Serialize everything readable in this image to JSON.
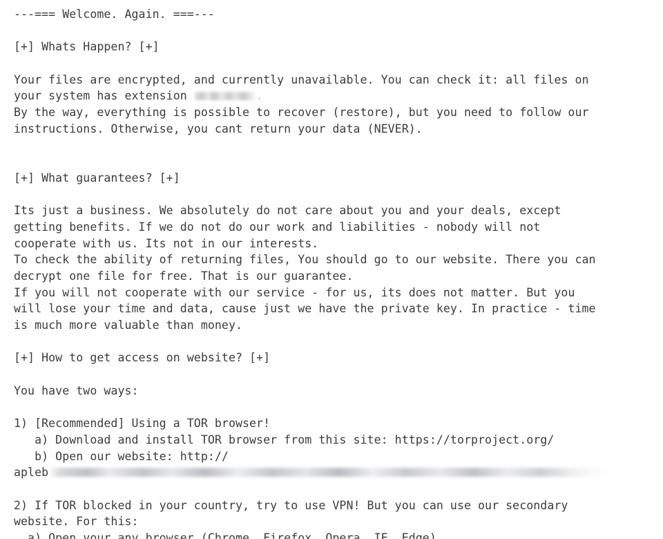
{
  "document": {
    "type": "ransom-note",
    "background_color": "#ffffff",
    "text_color": "#3c3c3c",
    "redaction_color": "#b4b6bb",
    "title_banner": "---=== Welcome. Again. ===---",
    "sections": [
      {
        "heading": "[+] Whats Happen? [+]",
        "lines": [
          "Your files are encrypted, and currently unavailable. You can check it: all files on",
          "your system has extension ",
          "By the way, everything is possible to recover (restore), but you need to follow our",
          "instructions. Otherwise, you cant return your data (NEVER)."
        ]
      },
      {
        "heading": "[+] What guarantees? [+]",
        "lines": [
          "Its just a business. We absolutely do not care about you and your deals, except",
          "getting benefits. If we do not do our work and liabilities - nobody will not",
          "cooperate with us. Its not in our interests.",
          "To check the ability of returning files, You should go to our website. There you can",
          "decrypt one file for free. That is our guarantee.",
          "If you will not cooperate with our service - for us, its does not matter. But you",
          "will lose your time and data, cause just we have the private key. In practice - time",
          "is much more valuable than money."
        ]
      },
      {
        "heading": "[+] How to get access on website? [+]",
        "lines": [
          "You have two ways:",
          "1) [Recommended] Using a TOR browser!",
          "   a) Download and install TOR browser from this site: https://torproject.org/",
          "   b) Open our website: http://",
          "apleb",
          "2) If TOR blocked in your country, try to use VPN! But you can use our secondary",
          "website. For this:"
        ]
      }
    ]
  },
  "text": {
    "banner": "---=== Welcome. Again. ===---",
    "h1": "[+] Whats Happen? [+]",
    "p1_l1": "Your files are encrypted, and currently unavailable. You can check it: all files on",
    "p1_l2_prefix": "your system has extension ",
    "p1_l2_suffix": ".",
    "p1_l3": "By the way, everything is possible to recover (restore), but you need to follow our",
    "p1_l4": "instructions. Otherwise, you cant return your data (NEVER).",
    "h2": "[+] What guarantees? [+]",
    "p2_l1": "Its just a business. We absolutely do not care about you and your deals, except",
    "p2_l2": "getting benefits. If we do not do our work and liabilities - nobody will not",
    "p2_l3": "cooperate with us. Its not in our interests.",
    "p2_l4": "To check the ability of returning files, You should go to our website. There you can",
    "p2_l5": "decrypt one file for free. That is our guarantee.",
    "p2_l6": "If you will not cooperate with our service - for us, its does not matter. But you",
    "p2_l7": "will lose your time and data, cause just we have the private key. In practice - time",
    "p2_l8": "is much more valuable than money.",
    "h3": "[+] How to get access on website? [+]",
    "p3_l1": "You have two ways:",
    "way1": "1) [Recommended] Using a TOR browser!",
    "way1_a": "   a) Download and install TOR browser from this site: https://torproject.org/",
    "way1_b": "   b) Open our website: http://",
    "onion_prefix": "apleb",
    "way2_l1": "2) If TOR blocked in your country, try to use VPN! But you can use our secondary",
    "way2_l2": "website. For this:",
    "clipped_tail": "  a) Open your any browser (Chrome, Firefox, Opera, IE, Edge)"
  },
  "redactions": {
    "extension_label": "file-extension-redacted",
    "onion_label": "onion-address-redacted"
  }
}
